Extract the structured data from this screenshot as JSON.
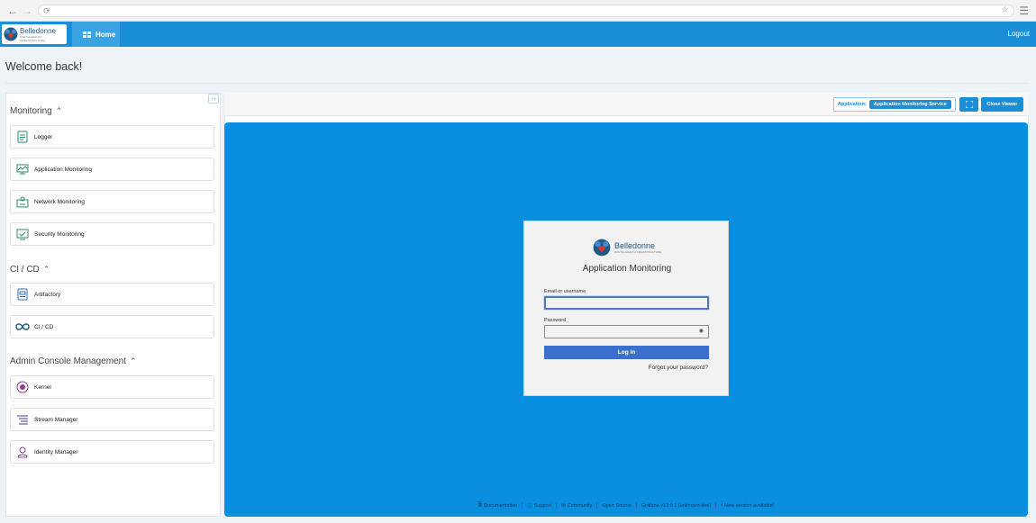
{
  "browser": {
    "back_icon": "←",
    "forward_icon": "→",
    "reload_icon": "⟳",
    "bookmark_icon": "☆",
    "menu_icon": "☰"
  },
  "header": {
    "logo_name": "Belledonne",
    "logo_tagline": "DIGITAL HEALTH INFRASTRUCTURE",
    "home_label": "Home",
    "logout_label": "Logout"
  },
  "welcome": "Welcome back!",
  "sidebar": {
    "collapse_icon": "↔",
    "sections": [
      {
        "title": "Monitoring",
        "items": [
          "Logger",
          "Application Monitoring",
          "Network Monitoring",
          "Security Monitoring"
        ]
      },
      {
        "title": "CI / CD",
        "items": [
          "Artifactory",
          "CI / CD"
        ]
      },
      {
        "title": "Admin Console Management",
        "items": [
          "Kernel",
          "Stream Manager",
          "Identity Manager"
        ]
      }
    ]
  },
  "viewer": {
    "application_key": "Application:",
    "application_value": "Application Monitoring Service",
    "close_label": "Close Viewer"
  },
  "login": {
    "logo_name": "Belledonne",
    "logo_tagline": "DIGITAL HEALTH INFRASTRUCTURE",
    "title": "Application Monitoring",
    "email_label": "Email or username",
    "email_value": "",
    "password_label": "Password",
    "password_value": "",
    "login_button": "Log in",
    "forgot_link": "Forgot your password?"
  },
  "footer": {
    "items": [
      "Documentation",
      "Support",
      "Community",
      "Open Source",
      "Grafana v12.0.1 (unknown-dev)",
      "New version available!"
    ]
  },
  "colors": {
    "accent": "#1a8fd8",
    "frame": "#0a8ee0",
    "login_button": "#3a6fd0"
  }
}
